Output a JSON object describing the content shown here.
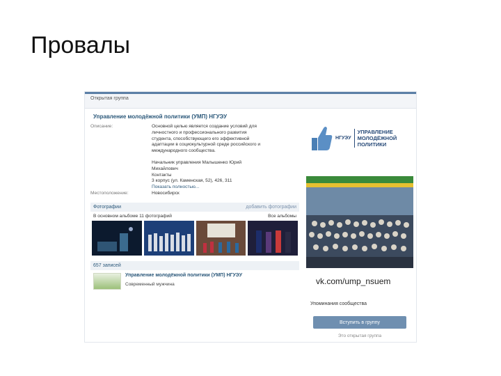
{
  "slide": {
    "title": "Провалы"
  },
  "vk": {
    "group_type": "Открытая группа",
    "group_name": "Управление молодёжной политики (УМП) НГУЭУ",
    "info": [
      {
        "label": "Описание:",
        "lines": [
          "Основной целью является создание условий для",
          "личностного и профессионального развития",
          "студента, способствующего его эффективной",
          "адаптации в социокультурной среде российского и",
          "международного сообщества.",
          "",
          "Начальник управления Малышенко Юрий",
          "Михайлович",
          "Контакты",
          "3 корпус (ул. Каменская, 52), 426, 311"
        ],
        "link": "Показать полностью..."
      },
      {
        "label": "Местоположение:",
        "lines": [
          "Новосибирск"
        ],
        "link": ""
      }
    ],
    "photos_header": "Фотографии",
    "add_photos": "добавить фотографии",
    "album_text": "В основном альбоме 11 фотографий",
    "all_albums": "Все альбомы",
    "posts_count": "657 записей",
    "post_author": "Управление молодёжной политики (УМП) НГУЭУ",
    "post_sub": "Современный мужчина",
    "logo_abbr": "НГУЭУ",
    "logo_lines": [
      "УПРАВЛЕНИЕ",
      "МОЛОДЁЖНОЙ",
      "ПОЛИТИКИ"
    ],
    "url": "vk.com/ump_nsuem",
    "mention_link": "Упоминания сообщества",
    "join_button": "Вступить в группу",
    "join_note": "Это открытая группа"
  }
}
